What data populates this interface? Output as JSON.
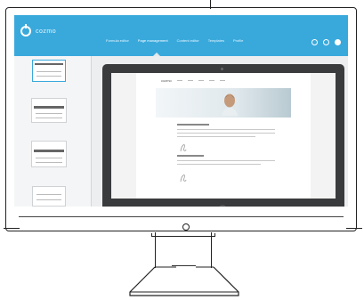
{
  "app": {
    "logo_text": "cozmo"
  },
  "nav": {
    "items": [
      "Formula editor",
      "Page management",
      "Content editor",
      "Templates",
      "Profile"
    ],
    "active_index": 1
  },
  "actions": [
    "eye-icon",
    "gear-icon",
    "user-icon"
  ],
  "colors": {
    "accent": "#39a9dc",
    "screen_bg": "#e6e8ea",
    "device": "#3a3b3d"
  },
  "preview": {
    "site_logo": "cozmo"
  }
}
